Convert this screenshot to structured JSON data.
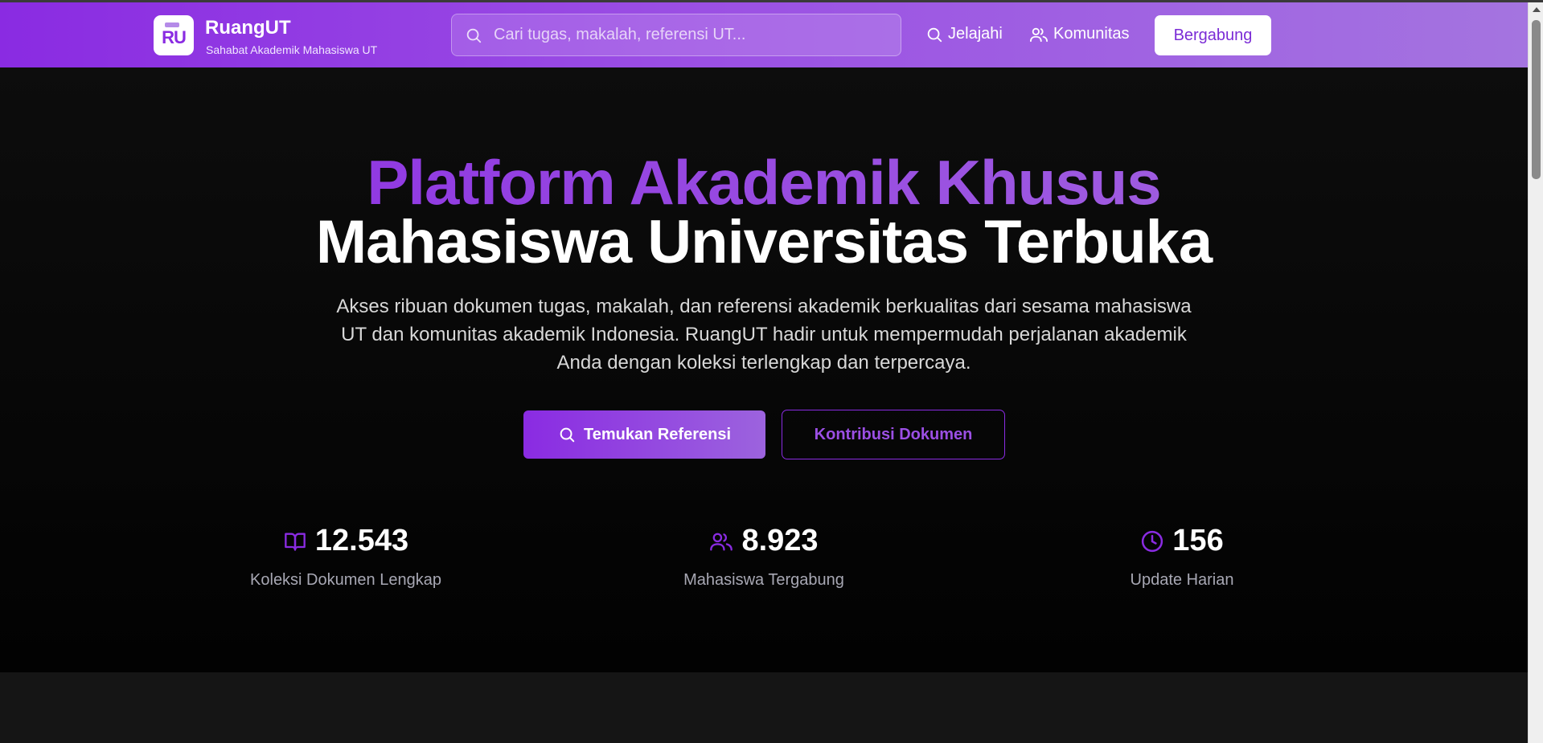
{
  "header": {
    "logo_text": "RU",
    "brand_name": "RuangUT",
    "tagline": "Sahabat Akademik Mahasiswa UT",
    "search_placeholder": "Cari tugas, makalah, referensi UT...",
    "nav": [
      {
        "label": "Jelajahi",
        "icon": "search-icon"
      },
      {
        "label": "Komunitas",
        "icon": "users-icon"
      }
    ],
    "join_label": "Bergabung"
  },
  "hero": {
    "title_line1": "Platform Akademik Khusus",
    "title_line2": "Mahasiswa Universitas Terbuka",
    "description": "Akses ribuan dokumen tugas, makalah, dan referensi akademik berkualitas dari sesama mahasiswa UT dan komunitas akademik Indonesia. RuangUT hadir untuk mempermudah perjalanan akademik Anda dengan koleksi terlengkap dan terpercaya.",
    "primary_button": "Temukan Referensi",
    "secondary_button": "Kontribusi Dokumen"
  },
  "stats": [
    {
      "value": "12.543",
      "label": "Koleksi Dokumen Lengkap",
      "icon": "book-open-icon"
    },
    {
      "value": "8.923",
      "label": "Mahasiswa Tergabung",
      "icon": "users-icon"
    },
    {
      "value": "156",
      "label": "Update Harian",
      "icon": "clock-icon"
    }
  ],
  "colors": {
    "accent": "#8a2be2",
    "accent_light": "#a56ae0",
    "background": "#0a0a0a"
  }
}
